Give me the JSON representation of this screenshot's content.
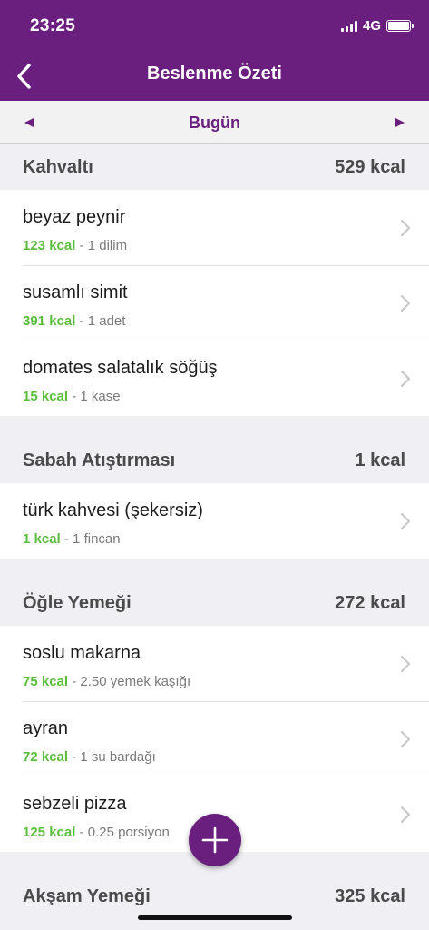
{
  "status_bar": {
    "time": "23:25",
    "network": "4G"
  },
  "nav": {
    "title": "Beslenme Özeti"
  },
  "date_nav": {
    "label": "Bugün"
  },
  "meals": [
    {
      "name": "Kahvaltı",
      "total": "529 kcal",
      "items": [
        {
          "name": "beyaz peynir",
          "kcal": "123 kcal",
          "portion": "- 1 dilim"
        },
        {
          "name": "susamlı simit",
          "kcal": "391 kcal",
          "portion": "- 1 adet"
        },
        {
          "name": "domates salatalık söğüş",
          "kcal": "15 kcal",
          "portion": "- 1 kase"
        }
      ]
    },
    {
      "name": "Sabah Atıştırması",
      "total": "1 kcal",
      "items": [
        {
          "name": "türk kahvesi (şekersiz)",
          "kcal": "1 kcal",
          "portion": "- 1 fincan"
        }
      ]
    },
    {
      "name": "Öğle Yemeği",
      "total": "272 kcal",
      "items": [
        {
          "name": "soslu makarna",
          "kcal": "75 kcal",
          "portion": "- 2.50 yemek kaşığı"
        },
        {
          "name": "ayran",
          "kcal": "72 kcal",
          "portion": "- 1 su bardağı"
        },
        {
          "name": "sebzeli pizza",
          "kcal": "125 kcal",
          "portion": "- 0.25 porsiyon"
        }
      ]
    },
    {
      "name": "Akşam Yemeği",
      "total": "325 kcal",
      "items": []
    }
  ],
  "colors": {
    "brand_purple": "#6a1f7f",
    "kcal_green": "#5bbd3d",
    "section_bg": "#efeff4"
  },
  "icons": {
    "back": "chevron-left-icon",
    "prev_day": "triangle-left-icon",
    "next_day": "triangle-right-icon",
    "row": "chevron-right-icon",
    "add": "plus-icon"
  }
}
